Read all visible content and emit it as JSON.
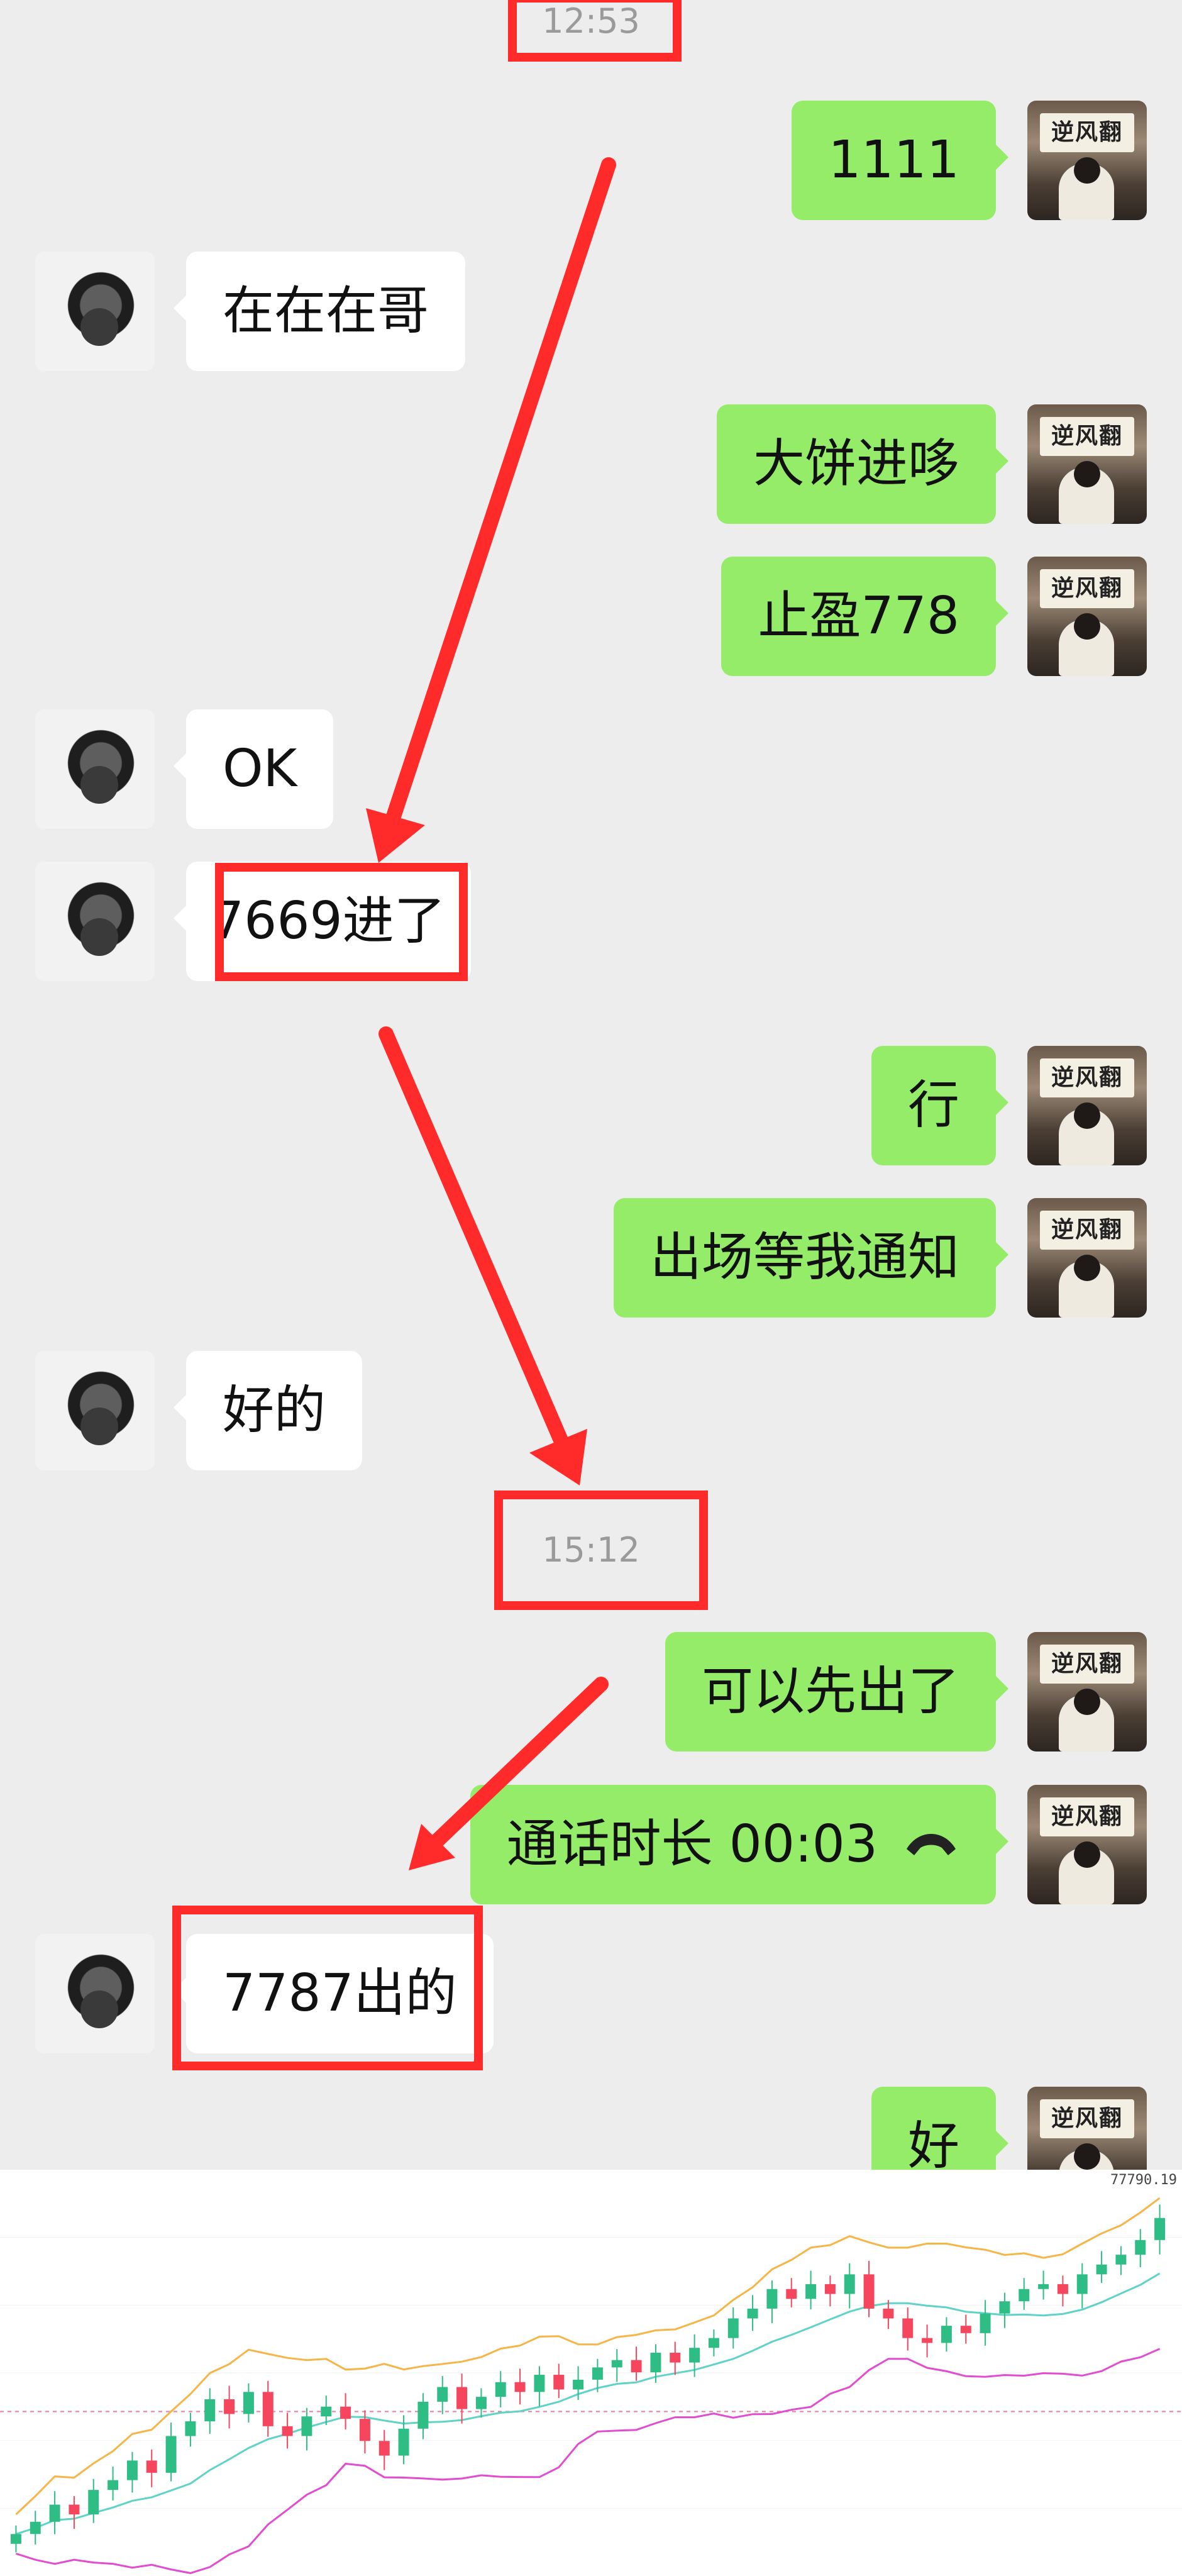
{
  "chat": {
    "timestamps": [
      "12:53",
      "15:12"
    ],
    "messages": [
      {
        "side": "right",
        "text": "1111"
      },
      {
        "side": "left",
        "text": "在在在哥"
      },
      {
        "side": "right",
        "text": "大饼进哆"
      },
      {
        "side": "right",
        "text": "止盈778"
      },
      {
        "side": "left",
        "text": "OK"
      },
      {
        "side": "left",
        "text": "7669进了"
      },
      {
        "side": "right",
        "text": "行"
      },
      {
        "side": "right",
        "text": "出场等我通知"
      },
      {
        "side": "left",
        "text": "好的"
      },
      {
        "side": "right",
        "text": "可以先出了"
      },
      {
        "side": "right",
        "text": "通话时长  00:03"
      },
      {
        "side": "left",
        "text": "7787出的"
      },
      {
        "side": "right",
        "text": "好"
      }
    ],
    "self_avatar_text": "逆风翻盘",
    "call_icon": "phone-hangup-icon",
    "colors": {
      "bubble_self": "#95ec69",
      "bubble_friend": "#ffffff",
      "annotation": "#ff2b2b",
      "background": "#ededed"
    }
  },
  "chart_data": {
    "type": "candlestick",
    "last_price_label": "77790.19",
    "indicators": [
      "bollinger-upper",
      "bollinger-middle",
      "bollinger-lower"
    ],
    "closes": [
      76500,
      76550,
      76620,
      76580,
      76680,
      76720,
      76800,
      76750,
      76900,
      76960,
      77050,
      76990,
      77080,
      76940,
      76900,
      76980,
      77020,
      76970,
      76880,
      76820,
      76930,
      77040,
      77100,
      77010,
      77060,
      77120,
      77080,
      77150,
      77090,
      77130,
      77180,
      77210,
      77160,
      77240,
      77200,
      77260,
      77300,
      77380,
      77420,
      77500,
      77460,
      77520,
      77480,
      77560,
      77420,
      77380,
      77300,
      77280,
      77350,
      77320,
      77400,
      77450,
      77500,
      77520,
      77480,
      77560,
      77600,
      77640,
      77700,
      77790
    ],
    "colors": {
      "up": "#2ebd85",
      "down": "#f6465d",
      "upper": "#f5b547",
      "middle": "#5fd3c8",
      "lower": "#e14cd0"
    }
  }
}
